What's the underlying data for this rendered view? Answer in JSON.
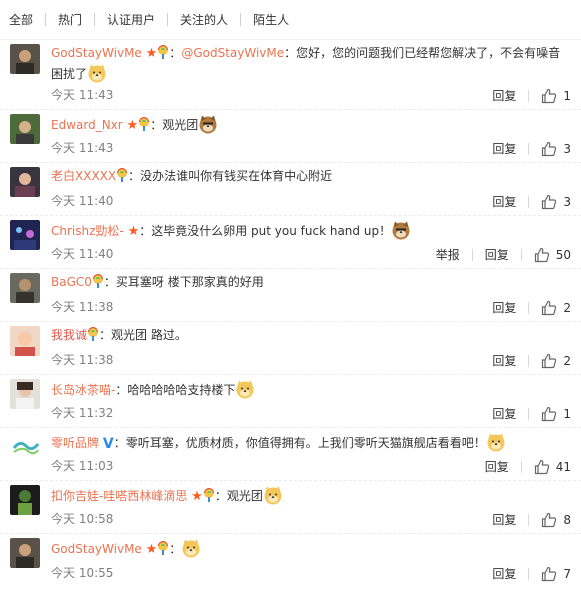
{
  "tabs": [
    "全部",
    "热门",
    "认证用户",
    "关注的人",
    "陌生人"
  ],
  "actions": {
    "reply": "回复",
    "report": "举报"
  },
  "comments": [
    {
      "user": "GodStayWivMe",
      "mention": "@GodStayWivMe",
      "text": "：您好，您的问题我们已经帮您解决了，不会有噪音困扰了",
      "time": "今天 11:43",
      "likes": "1"
    },
    {
      "user": "Edward_Nxr",
      "text": "：观光团",
      "time": "今天 11:43",
      "likes": "3"
    },
    {
      "user": "老白XXXXX",
      "text": "：没办法谁叫你有钱买在体育中心附近",
      "time": "今天 11:40",
      "likes": "3"
    },
    {
      "user": "Chrishz勁松-",
      "text": "：这毕竟没什么卵用 put you fuck hand up！",
      "time": "今天 11:40",
      "likes": "50"
    },
    {
      "user": "BaGC0",
      "text": "：买耳塞呀 楼下那家真的好用",
      "time": "今天 11:38",
      "likes": "2"
    },
    {
      "user": "我我诚",
      "text": "：观光团 路过。",
      "time": "今天 11:38",
      "likes": "2"
    },
    {
      "user": "长岛冰茶喵-",
      "text": "：哈哈哈哈哈支持楼下",
      "time": "今天 11:32",
      "likes": "1"
    },
    {
      "user": "零听品牌",
      "text": "：零听耳塞，优质材质，你值得拥有。上我们零听天猫旗舰店看看吧！",
      "time": "今天 11:03",
      "likes": "41"
    },
    {
      "user": "扣你吉娃-哇嗒西林峰滴思",
      "text": "：观光团",
      "time": "今天 10:58",
      "likes": "8"
    },
    {
      "user": "GodStayWivMe",
      "text": "：",
      "time": "今天 10:55",
      "likes": "7"
    }
  ],
  "colors": {
    "username": "#eb7350",
    "star": "#ff5a1f",
    "verified": "#2a8ae8"
  },
  "icons": {
    "medal": "rainbow-medal-icon",
    "star": "star-icon",
    "emoji": "doge-emoji-icon",
    "like": "thumbs-up-icon"
  }
}
